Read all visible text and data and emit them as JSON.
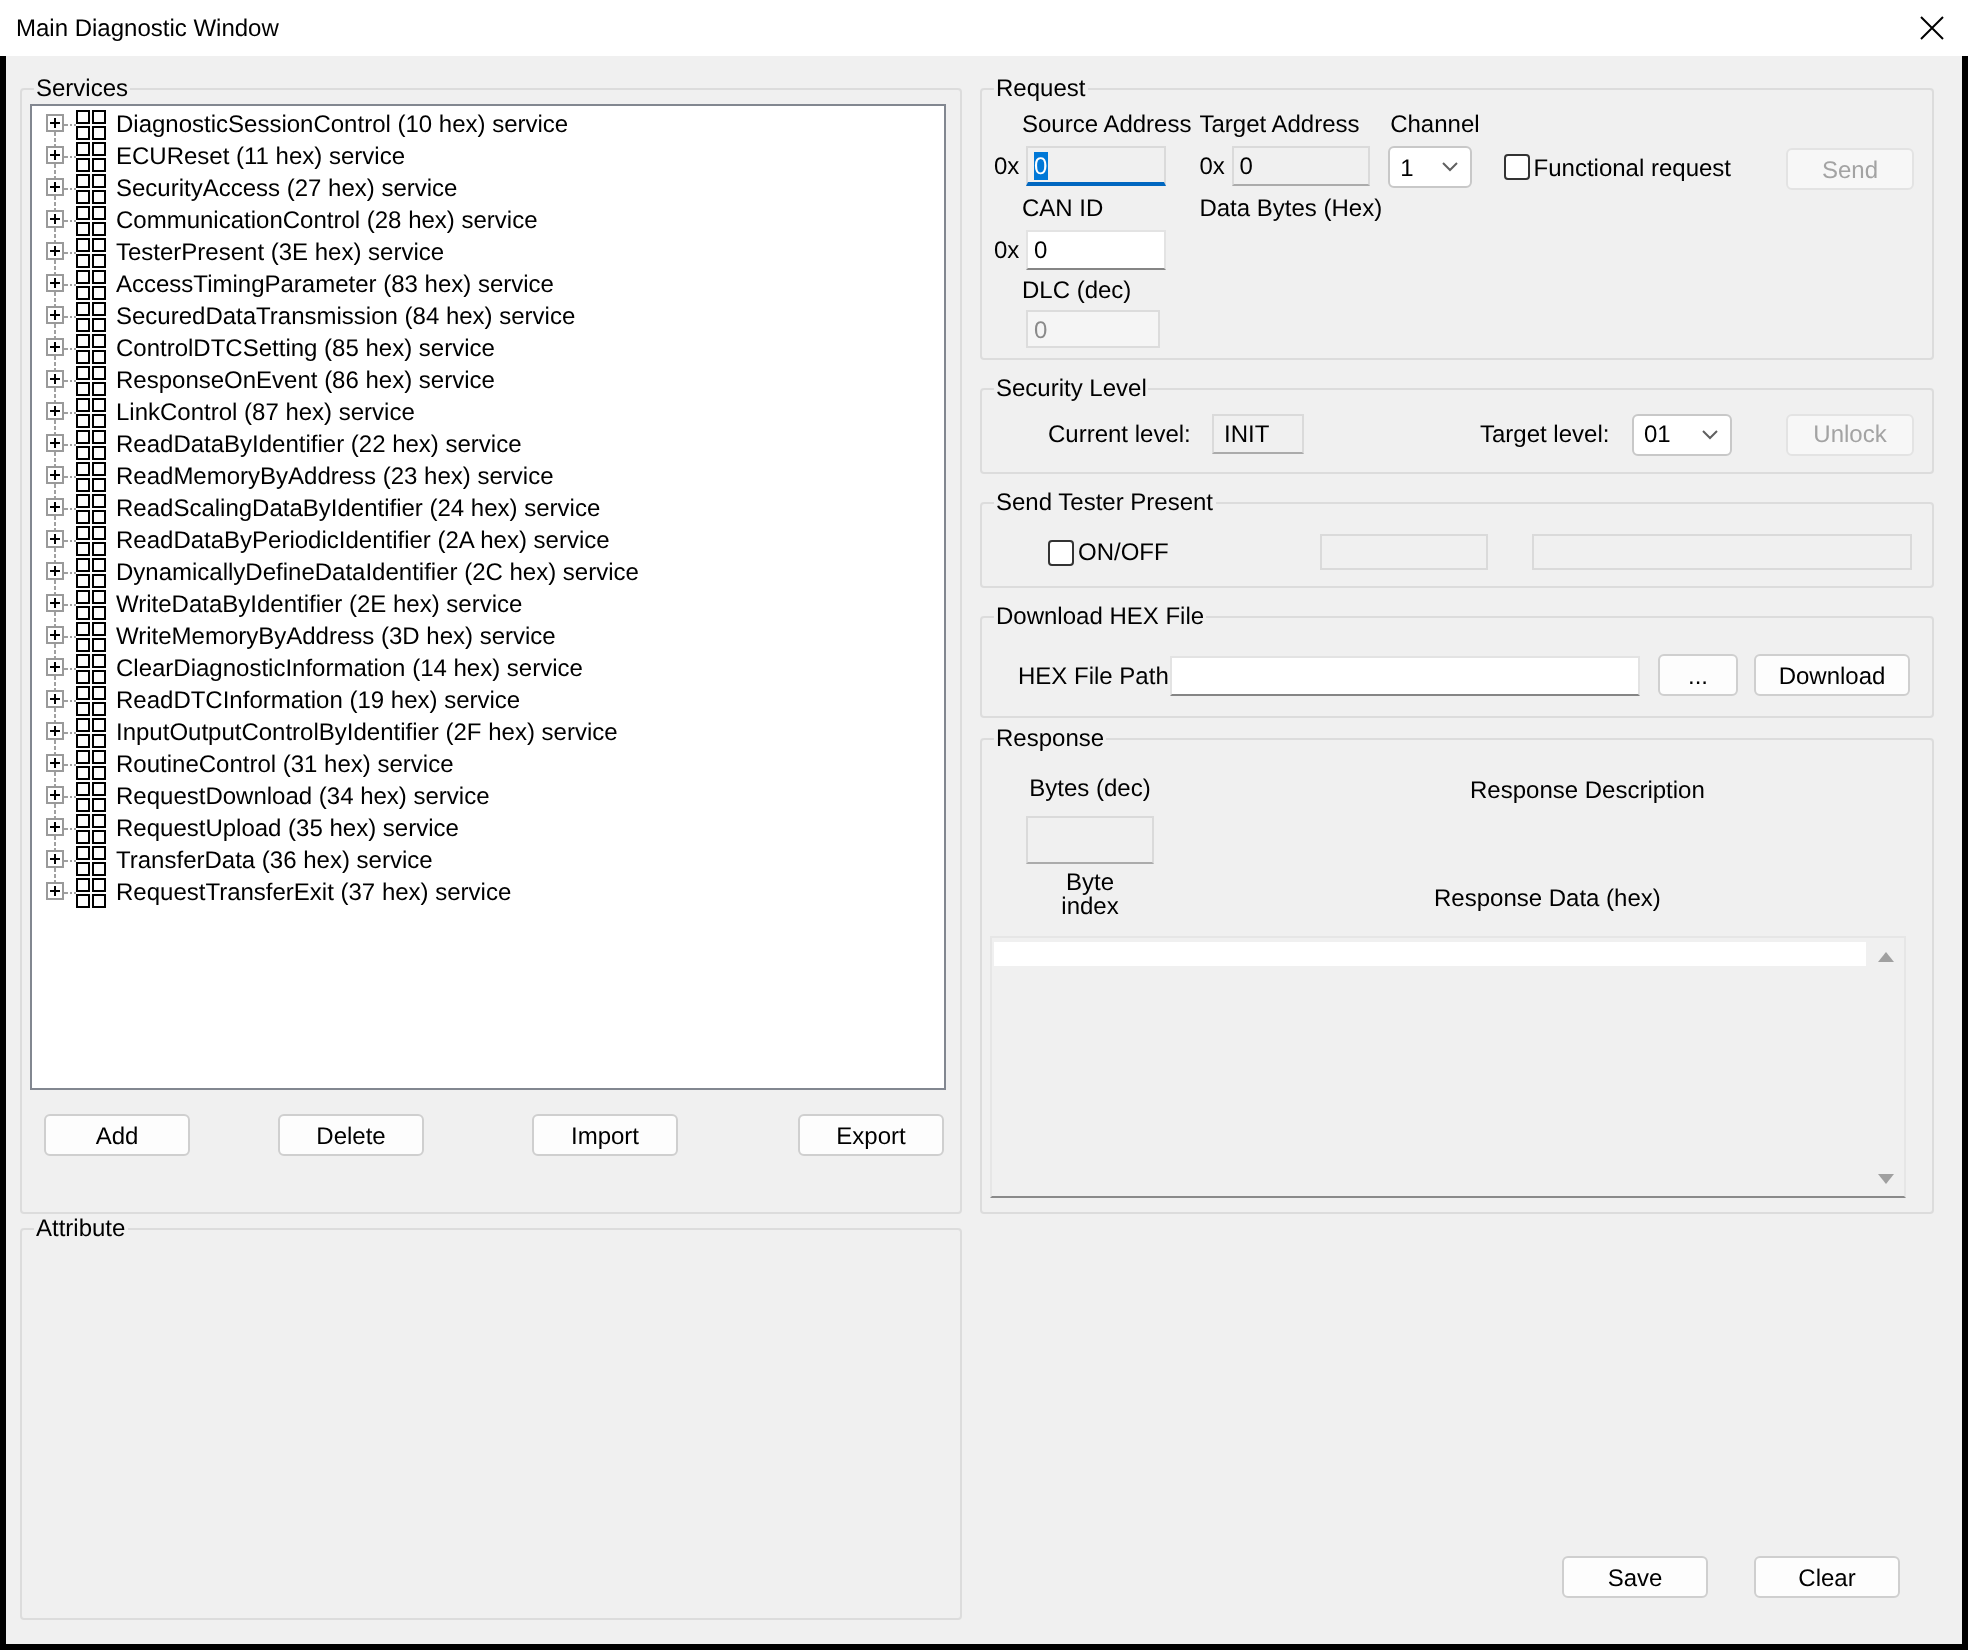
{
  "window": {
    "title": "Main Diagnostic Window"
  },
  "services": {
    "title": "Services",
    "items": [
      {
        "label": "DiagnosticSessionControl (10 hex) service",
        "expanded": false
      },
      {
        "label": "ECUReset (11 hex) service",
        "expanded": false
      },
      {
        "label": "SecurityAccess (27 hex) service",
        "expanded": false
      },
      {
        "label": "CommunicationControl (28 hex) service",
        "expanded": false
      },
      {
        "label": "TesterPresent (3E hex) service",
        "expanded": false
      },
      {
        "label": "AccessTimingParameter (83 hex) service",
        "expanded": false
      },
      {
        "label": "SecuredDataTransmission (84 hex) service",
        "expanded": false
      },
      {
        "label": "ControlDTCSetting (85 hex) service",
        "expanded": false
      },
      {
        "label": "ResponseOnEvent (86 hex) service",
        "expanded": false
      },
      {
        "label": "LinkControl (87 hex) service",
        "expanded": false
      },
      {
        "label": "ReadDataByIdentifier (22 hex) service",
        "expanded": false
      },
      {
        "label": "ReadMemoryByAddress (23 hex) service",
        "expanded": false
      },
      {
        "label": "ReadScalingDataByIdentifier (24 hex) service",
        "expanded": false
      },
      {
        "label": "ReadDataByPeriodicIdentifier (2A hex) service",
        "expanded": false
      },
      {
        "label": "DynamicallyDefineDataIdentifier (2C hex) service",
        "expanded": false
      },
      {
        "label": "WriteDataByIdentifier (2E hex) service",
        "expanded": false
      },
      {
        "label": "WriteMemoryByAddress (3D hex) service",
        "expanded": false
      },
      {
        "label": "ClearDiagnosticInformation (14 hex) service",
        "expanded": false
      },
      {
        "label": "ReadDTCInformation (19 hex) service",
        "expanded": false
      },
      {
        "label": "InputOutputControlByIdentifier (2F hex) service",
        "expanded": false
      },
      {
        "label": "RoutineControl (31 hex) service",
        "expanded": false
      },
      {
        "label": "RequestDownload (34 hex) service",
        "expanded": false
      },
      {
        "label": "RequestUpload (35 hex) service",
        "expanded": false
      },
      {
        "label": "TransferData (36 hex) service",
        "expanded": false
      },
      {
        "label": "RequestTransferExit (37 hex) service",
        "expanded": false
      }
    ],
    "buttons": [
      {
        "label": "Add",
        "disabled": false
      },
      {
        "label": "Delete",
        "disabled": false
      },
      {
        "label": "Import",
        "disabled": false
      },
      {
        "label": "Export",
        "disabled": false
      }
    ]
  },
  "attribute": {
    "title": "Attribute"
  },
  "request": {
    "title": "Request",
    "source_address": {
      "label": "Source Address",
      "prefix": "0x",
      "value": "0",
      "read_only": true,
      "focused": true
    },
    "target_address": {
      "label": "Target Address",
      "prefix": "0x",
      "value": "0",
      "read_only": true,
      "focused": false
    },
    "channel": {
      "label": "Channel",
      "value": "1"
    },
    "functional_request": {
      "label": "Functional request",
      "checked": false
    },
    "send_button": {
      "label": "Send",
      "disabled": true
    },
    "can_id": {
      "label": "CAN ID",
      "prefix": "0x",
      "value": "0",
      "read_only": false,
      "focused": false
    },
    "data_bytes": {
      "label": "Data Bytes (Hex)"
    },
    "dlc": {
      "label": "DLC (dec)",
      "value": "0",
      "disabled": true,
      "focused": false
    }
  },
  "security_level": {
    "title": "Security Level",
    "current_label": "Current level:",
    "current_value": "INIT",
    "target_label": "Target level:",
    "target_value": "01",
    "unlock_button": {
      "label": "Unlock",
      "disabled": true
    }
  },
  "tester_present": {
    "title": "Send Tester Present",
    "toggle": {
      "label": "ON/OFF",
      "checked": false
    }
  },
  "download_hex": {
    "title": "Download HEX File",
    "path_label": "HEX File Path",
    "browse_button": {
      "label": "...",
      "disabled": false
    },
    "download_button": {
      "label": "Download",
      "disabled": false
    }
  },
  "response": {
    "title": "Response",
    "bytes_label": "Bytes (dec)",
    "description_label": "Response Description",
    "byte_index_label": "Byte index",
    "data_label": "Response Data (hex)"
  },
  "footer_buttons": [
    {
      "label": "Save",
      "disabled": false
    },
    {
      "label": "Clear",
      "disabled": false
    }
  ]
}
